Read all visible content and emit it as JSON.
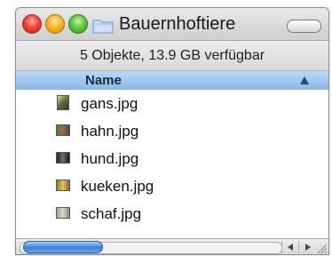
{
  "window": {
    "title": "Bauernhoftiere",
    "icons": [
      "close-icon",
      "minimize-icon",
      "zoom-icon",
      "folder-icon",
      "toolbar-toggle"
    ]
  },
  "statusbar": {
    "text": "5 Objekte, 13.9 GB verfügbar"
  },
  "list": {
    "column_header": "Name",
    "sort": "ascending",
    "items": [
      {
        "name": "gans.jpg",
        "icon": "image-thumbnail-icon"
      },
      {
        "name": "hahn.jpg",
        "icon": "image-thumbnail-icon"
      },
      {
        "name": "hund.jpg",
        "icon": "image-thumbnail-icon"
      },
      {
        "name": "kueken.jpg",
        "icon": "image-thumbnail-icon"
      },
      {
        "name": "schaf.jpg",
        "icon": "image-thumbnail-icon"
      }
    ]
  },
  "colors": {
    "header_blue": "#86b6e8",
    "scroll_thumb_blue": "#3b7fd6"
  }
}
